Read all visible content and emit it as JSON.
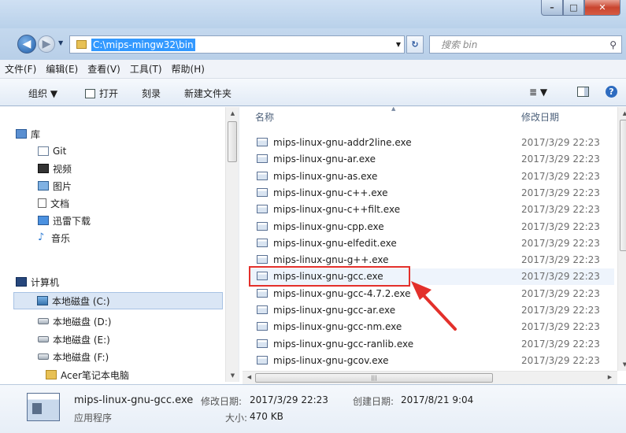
{
  "window": {
    "controls": {
      "minimize": "–",
      "maximize": "□",
      "close": "✕"
    }
  },
  "address": {
    "path": "C:\\mips-mingw32\\bin",
    "search_placeholder": "搜索 bin"
  },
  "menu": [
    "文件(F)",
    "编辑(E)",
    "查看(V)",
    "工具(T)",
    "帮助(H)"
  ],
  "toolbar": {
    "organize": "组织 ▼",
    "open": "打开",
    "burn": "刻录",
    "new_folder": "新建文件夹",
    "view_icon": "≣ ▼",
    "help": "?"
  },
  "nav": {
    "libraries": "库",
    "git": "Git",
    "videos": "视频",
    "pictures": "图片",
    "documents": "文档",
    "thunder": "迅雷下载",
    "music": "音乐",
    "computer": "计算机",
    "drive_c": "本地磁盘 (C:)",
    "drive_d": "本地磁盘 (D:)",
    "drive_e": "本地磁盘 (E:)",
    "drive_f": "本地磁盘 (F:)",
    "acer": "Acer笔记本电脑"
  },
  "columns": {
    "name": "名称",
    "modified": "修改日期"
  },
  "files": [
    {
      "name": "mips-linux-gnu-addr2line.exe",
      "date": "2017/3/29 22:23"
    },
    {
      "name": "mips-linux-gnu-ar.exe",
      "date": "2017/3/29 22:23"
    },
    {
      "name": "mips-linux-gnu-as.exe",
      "date": "2017/3/29 22:23"
    },
    {
      "name": "mips-linux-gnu-c++.exe",
      "date": "2017/3/29 22:23"
    },
    {
      "name": "mips-linux-gnu-c++filt.exe",
      "date": "2017/3/29 22:23"
    },
    {
      "name": "mips-linux-gnu-cpp.exe",
      "date": "2017/3/29 22:23"
    },
    {
      "name": "mips-linux-gnu-elfedit.exe",
      "date": "2017/3/29 22:23"
    },
    {
      "name": "mips-linux-gnu-g++.exe",
      "date": "2017/3/29 22:23"
    },
    {
      "name": "mips-linux-gnu-gcc.exe",
      "date": "2017/3/29 22:23"
    },
    {
      "name": "mips-linux-gnu-gcc-4.7.2.exe",
      "date": "2017/3/29 22:23"
    },
    {
      "name": "mips-linux-gnu-gcc-ar.exe",
      "date": "2017/3/29 22:23"
    },
    {
      "name": "mips-linux-gnu-gcc-nm.exe",
      "date": "2017/3/29 22:23"
    },
    {
      "name": "mips-linux-gnu-gcc-ranlib.exe",
      "date": "2017/3/29 22:23"
    },
    {
      "name": "mips-linux-gnu-gcov.exe",
      "date": "2017/3/29 22:23"
    }
  ],
  "details": {
    "filename": "mips-linux-gnu-gcc.exe",
    "type": "应用程序",
    "modified_label": "修改日期:",
    "modified_value": "2017/3/29 22:23",
    "created_label": "创建日期:",
    "created_value": "2017/8/21 9:04",
    "size_label": "大小:",
    "size_value": "470 KB"
  },
  "annotation": {
    "highlight_color": "#e3302b"
  }
}
